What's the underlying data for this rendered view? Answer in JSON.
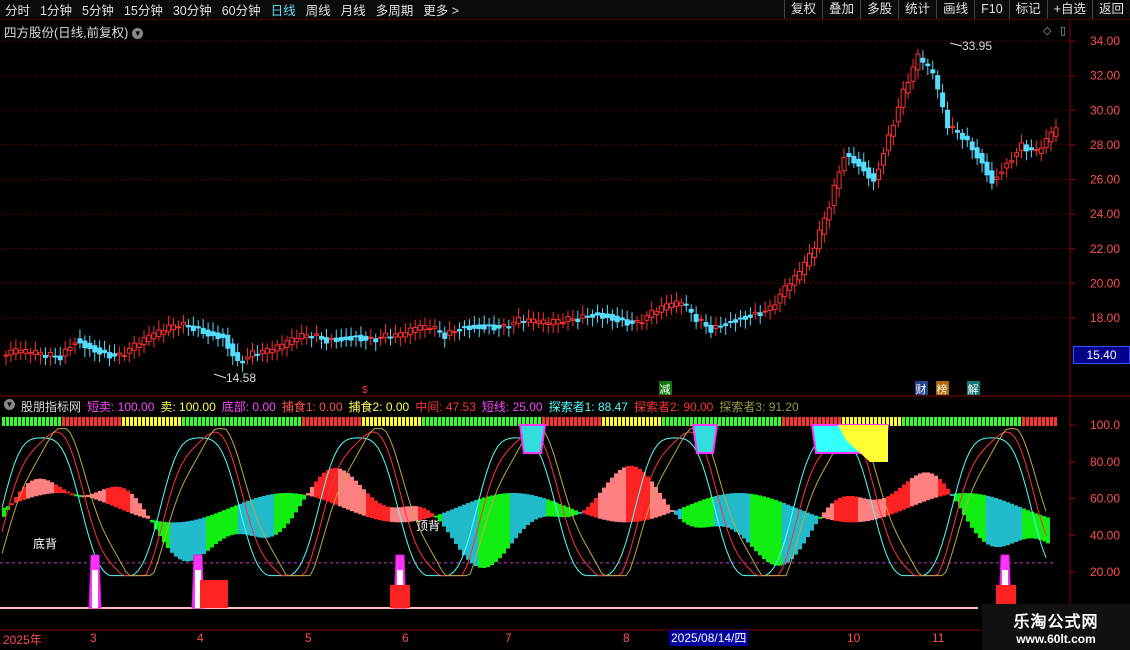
{
  "toolbar": {
    "periods": [
      "分时",
      "1分钟",
      "5分钟",
      "15分钟",
      "30分钟",
      "60分钟",
      "日线",
      "周线",
      "月线",
      "多周期",
      "更多 >"
    ],
    "active": "日线",
    "right_buttons": [
      "复权",
      "叠加",
      "多股",
      "统计",
      "画线",
      "F10",
      "标记",
      "+自选",
      "返回"
    ]
  },
  "stock": {
    "title": "四方股份(日线,前复权)",
    "last_price": "15.40",
    "high_label": "33.95",
    "low_label": "14.58"
  },
  "price_axis": {
    "ticks": [
      "34.00",
      "32.00",
      "30.00",
      "28.00",
      "26.00",
      "24.00",
      "22.00",
      "20.00",
      "18.00"
    ]
  },
  "markers": {
    "m1": "减",
    "m2": "财",
    "m3": "榜",
    "m4": "解"
  },
  "indicator": {
    "name": "股朋指标网",
    "values": [
      {
        "label": "短卖: 100.00",
        "color": "#ff44ff"
      },
      {
        "label": "卖: 100.00",
        "color": "#ffff55"
      },
      {
        "label": "底部: 0.00",
        "color": "#ff44ff"
      },
      {
        "label": "捕食1: 0.00",
        "color": "#ff5555"
      },
      {
        "label": "捕食2: 0.00",
        "color": "#ffff55"
      },
      {
        "label": "中间: 47.53",
        "color": "#ff3333"
      },
      {
        "label": "短线: 25.00",
        "color": "#ff44ff"
      },
      {
        "label": "探索者1: 88.47",
        "color": "#55ffff"
      },
      {
        "label": "探索者2: 90.00",
        "color": "#ff3333"
      },
      {
        "label": "探索者3: 91.20",
        "color": "#999944"
      }
    ],
    "ticks": [
      "100.0",
      "80.00",
      "60.00",
      "40.00",
      "20.00"
    ],
    "labels": {
      "bottom": "底背",
      "top": "顶背"
    }
  },
  "date_axis": {
    "labels": [
      "2025年",
      "3",
      "4",
      "5",
      "6",
      "7",
      "8",
      "10",
      "11"
    ],
    "cursor": "2025/08/14/四"
  },
  "watermark": {
    "line1": "乐淘公式网",
    "line2": "www.60lt.com"
  },
  "chart_data": {
    "type": "candlestick",
    "price_range": [
      14,
      35
    ],
    "series_close": [
      16.0,
      15.9,
      15.8,
      15.8,
      16.8,
      16.4,
      16.0,
      15.8,
      16.3,
      16.8,
      17.2,
      17.6,
      17.5,
      17.2,
      17.0,
      15.5,
      15.9,
      16.0,
      16.3,
      16.8,
      17.0,
      16.8,
      16.9,
      17.0,
      16.8,
      16.9,
      16.9,
      17.3,
      17.4,
      17.0,
      17.5,
      17.6,
      17.6,
      17.5,
      17.8,
      17.7,
      17.6,
      17.8,
      18.0,
      18.3,
      18.2,
      17.9,
      17.7,
      18.2,
      18.6,
      18.8,
      17.9,
      17.4,
      17.8,
      18.1,
      18.3,
      18.5,
      19.6,
      20.5,
      22.0,
      24.5,
      27.5,
      27.0,
      26.0,
      28.5,
      31.0,
      33.0,
      32.0,
      29.0,
      28.5,
      27.5,
      26.0,
      27.0,
      28.0,
      27.5,
      28.5,
      29.5
    ]
  }
}
